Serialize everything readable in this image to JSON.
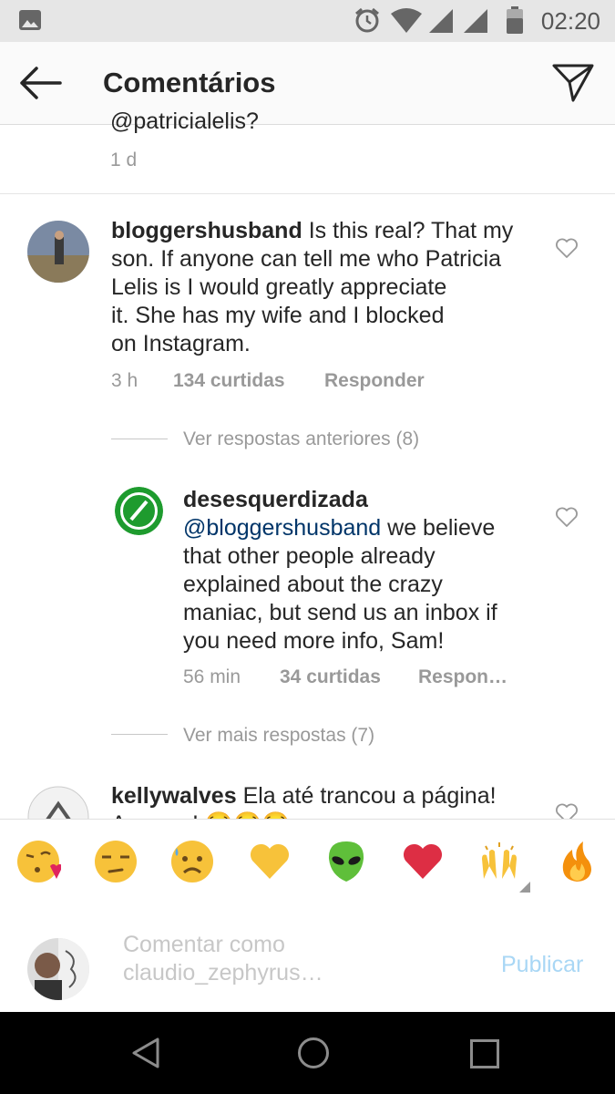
{
  "status_bar": {
    "time": "02:20",
    "icons": [
      "image-icon",
      "alarm-icon",
      "wifi-icon",
      "signal-icon",
      "signal-icon",
      "battery-icon"
    ]
  },
  "header": {
    "title": "Comentários",
    "back_icon": "arrow-left-icon",
    "send_icon": "paper-plane-icon"
  },
  "prev_comment": {
    "text_tail": "@patricialelis?",
    "time": "1 d"
  },
  "comment_main": {
    "username": "bloggershusband",
    "lines": [
      "Is this real? That my",
      "son. If anyone can tell me who Patricia",
      "Lelis is I would greatly appreciate",
      "it. She has my wife and I blocked",
      "on Instagram."
    ],
    "time": "3 h",
    "likes": "134 curtidas",
    "reply": "Responder"
  },
  "view_previous": "Ver respostas anteriores (8)",
  "reply_comment": {
    "username": "desesquerdizada",
    "mention": "@bloggershusband",
    "lines": [
      "we believe",
      "that other people already",
      "explained about the crazy",
      "maniac, but send us an inbox if",
      "you need more info, Sam!"
    ],
    "time": "56 min",
    "likes": "34 curtidas",
    "reply": "Respon…"
  },
  "view_more": "Ver mais respostas (7)",
  "next_comment": {
    "username": "kellywalves",
    "text": "Ela até trancou a página!",
    "line2": "Arregou! 😭😭😭"
  },
  "emoji_bar": [
    "😘",
    "😒",
    "😥",
    "💛",
    "👽",
    "❤️",
    "🙌",
    "🔥"
  ],
  "input": {
    "placeholder_line1": "Comentar como",
    "placeholder_line2": "claudio_zephyrus…",
    "publish": "Publicar"
  },
  "nav_bar": {
    "icons": [
      "back-triangle-icon",
      "home-circle-icon",
      "recents-square-icon"
    ]
  }
}
